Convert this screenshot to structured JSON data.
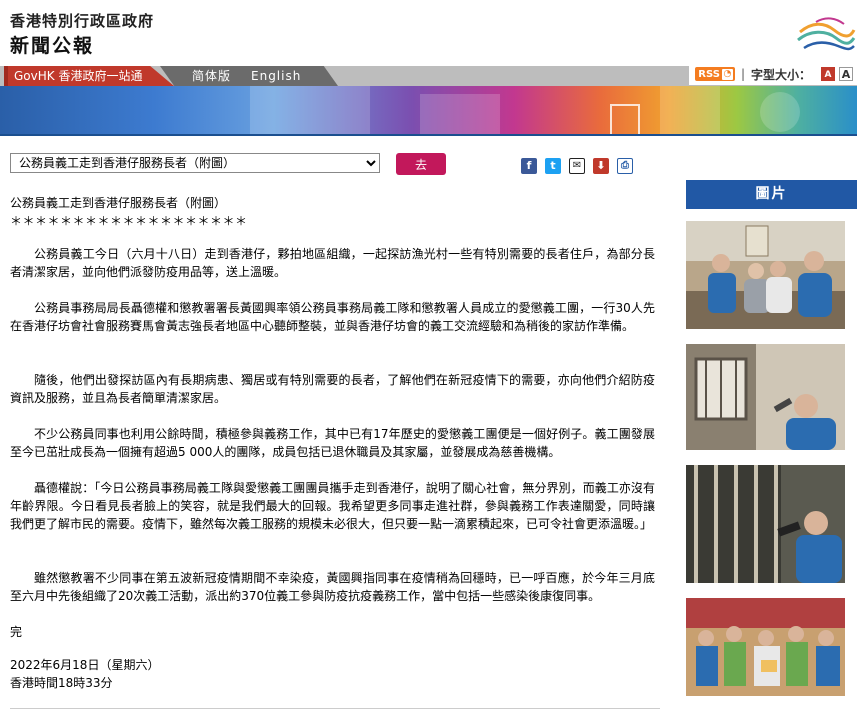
{
  "header": {
    "site_title": "香港特別行政區政府",
    "site_subtitle": "新聞公報"
  },
  "nav": {
    "govhk": "GovHK 香港政府一站通",
    "simplified": "简体版",
    "english": "English",
    "rss": "RSS",
    "font_size_label": "字型大小：",
    "font_small": "A",
    "font_large": "A"
  },
  "story_select": {
    "selected": "公務員義工走到香港仔服務長者（附圖）",
    "go_label": "去"
  },
  "share": {
    "facebook": "f",
    "twitter": "t",
    "mail": "✉",
    "save": "⬇",
    "print": "⎙"
  },
  "article": {
    "headline": "公務員義工走到香港仔服務長者（附圖）",
    "stars": "＊＊＊＊＊＊＊＊＊＊＊＊＊＊＊＊＊＊＊",
    "paragraphs": [
      "公務員義工今日（六月十八日）走到香港仔，夥拍地區組織，一起探訪漁光村一些有特別需要的長者住戶，為部分長者清潔家居，並向他們派發防疫用品等，送上溫暖。",
      "公務員事務局局長聶德權和懲教署署長黃國興率領公務員事務局義工隊和懲教署人員成立的愛懲義工團，一行30人先在香港仔坊會社會服務賽馬會黃志強長者地區中心聽師整裝，並與香港仔坊會的義工交流經驗和為稍後的家訪作準備。",
      "隨後，他們出發探訪區內有長期病患、獨居或有特別需要的長者，了解他們在新冠疫情下的需要，亦向他們介紹防疫資訊及服務，並且為長者簡單清潔家居。",
      "不少公務員同事也利用公餘時間，積極參與義務工作，其中已有17年歷史的愛懲義工團便是一個好例子。義工團發展至今已茁壯成長為一個擁有超過5 000人的團隊，成員包括已退休職員及其家屬，並發展成為慈善機構。",
      "聶德權說：「今日公務員事務局義工隊與愛懲義工團團員攜手走到香港仔，說明了關心社會，無分界別，而義工亦沒有年齡界限。今日看見長者臉上的笑容，就是我們最大的回報。我希望更多同事走進社群，參與義務工作表達關愛，同時讓我們更了解市民的需要。疫情下，雖然每次義工服務的規模未必很大，但只要一點一滴累積起來，已可令社會更添溫暖。」",
      "雖然懲教署不少同事在第五波新冠疫情期間不幸染疫，黃國興指同事在疫情稍為回穩時，已一呼百應，於今年三月底至六月中先後組織了20次義工活動，派出約370位義工參與防疫抗疫義務工作，當中包括一些感染後康復同事。"
    ],
    "end_mark": "完",
    "date": "2022年6月18日（星期六）",
    "time": "香港時間18時33分"
  },
  "sidebar": {
    "pictures_title": "圖片"
  }
}
